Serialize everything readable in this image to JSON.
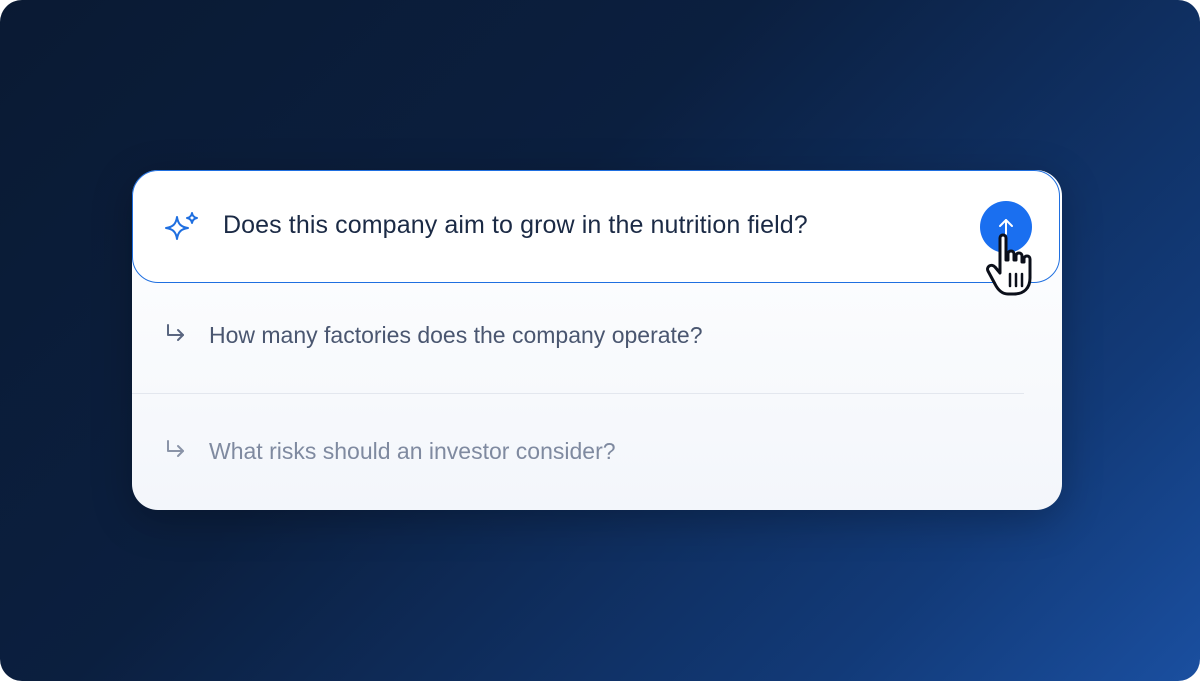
{
  "query": {
    "text": "Does this company aim to grow in the nutrition field?",
    "icon": "sparkle-icon",
    "submit_icon": "arrow-up-icon"
  },
  "suggestions": [
    {
      "text": "How many factories does the company operate?",
      "icon": "return-arrow-icon"
    },
    {
      "text": "What risks should an investor consider?",
      "icon": "return-arrow-icon"
    }
  ],
  "colors": {
    "accent": "#1a6ff0",
    "border": "#1f6fe0",
    "query_text": "#1b2a45",
    "suggestion_text": "#4a5670",
    "suggestion_text_faded": "#7f8aa0",
    "background_start": "#0a1a33",
    "background_end": "#1a4fa0"
  }
}
